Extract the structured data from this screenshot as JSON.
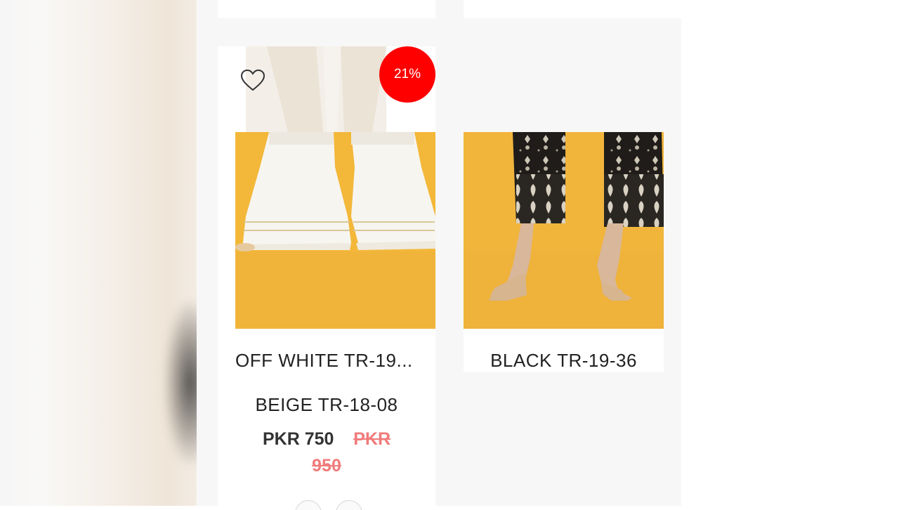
{
  "products": [
    {
      "name": "OFF WHITE TR-19...",
      "secondary_name": "BEIGE TR-18-08",
      "discount": "21%",
      "price": "PKR 750",
      "old_price_line1": "PKR",
      "old_price_line2": "950"
    },
    {
      "name": "BLACK TR-19-36"
    }
  ],
  "colors": {
    "discount_badge": "#ff0000",
    "old_price": "#f07b7b",
    "background_photo": "#f3b739"
  },
  "icons": [
    "heart-outline-icon"
  ]
}
